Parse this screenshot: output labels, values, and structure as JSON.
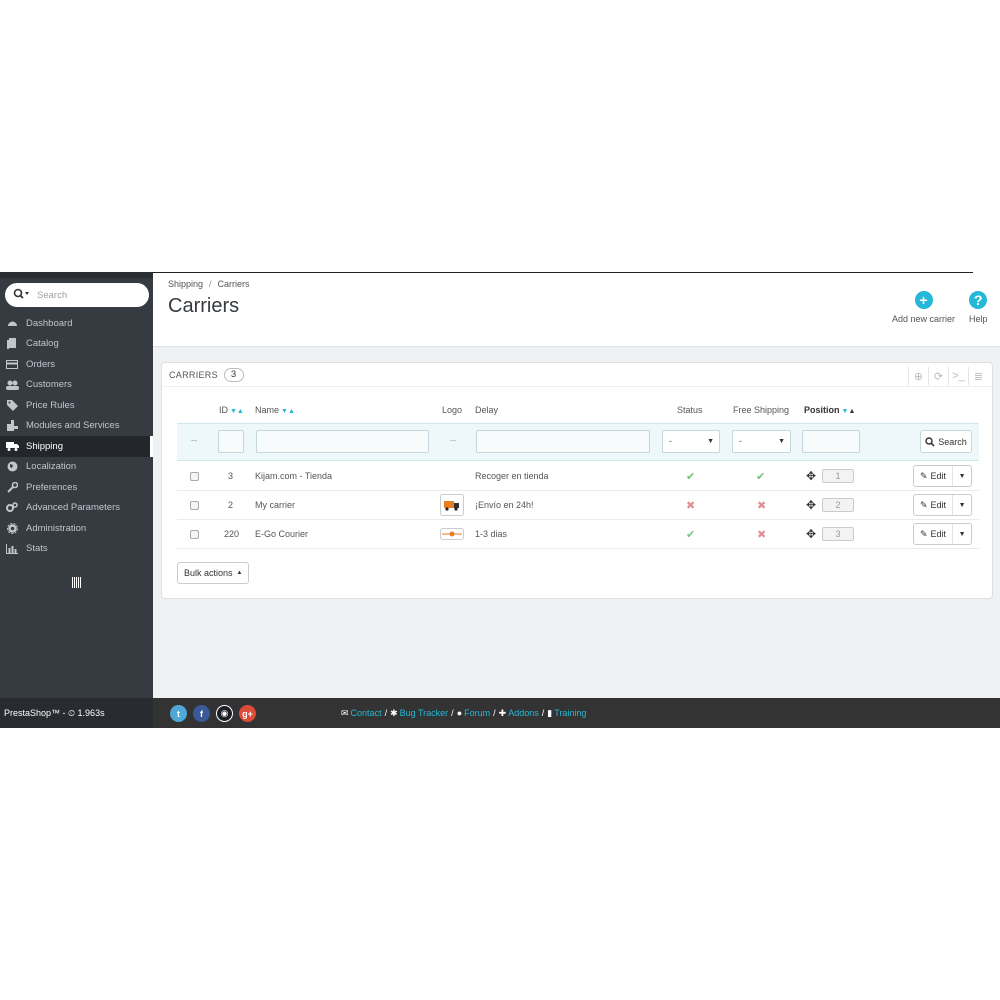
{
  "sidebar": {
    "search_placeholder": "Search",
    "items": [
      {
        "label": "Dashboard",
        "icon": "dashboard-icon"
      },
      {
        "label": "Catalog",
        "icon": "catalog-icon"
      },
      {
        "label": "Orders",
        "icon": "orders-icon"
      },
      {
        "label": "Customers",
        "icon": "customers-icon"
      },
      {
        "label": "Price Rules",
        "icon": "price-rules-icon"
      },
      {
        "label": "Modules and Services",
        "icon": "modules-icon"
      },
      {
        "label": "Shipping",
        "icon": "shipping-icon",
        "active": true
      },
      {
        "label": "Localization",
        "icon": "localization-icon"
      },
      {
        "label": "Preferences",
        "icon": "preferences-icon"
      },
      {
        "label": "Advanced Parameters",
        "icon": "advanced-icon"
      },
      {
        "label": "Administration",
        "icon": "administration-icon"
      },
      {
        "label": "Stats",
        "icon": "stats-icon"
      }
    ]
  },
  "breadcrumb": {
    "first": "Shipping",
    "second": "Carriers",
    "separator": "/"
  },
  "page": {
    "title": "Carriers"
  },
  "toolbar": {
    "add_label": "Add new carrier",
    "help_label": "Help"
  },
  "panel": {
    "title": "CARRIERS",
    "count": "3"
  },
  "table": {
    "headers": {
      "id": "ID",
      "name": "Name",
      "logo": "Logo",
      "delay": "Delay",
      "status": "Status",
      "free_shipping": "Free Shipping",
      "position": "Position"
    },
    "filter": {
      "dash": "--",
      "select_value": "-",
      "search_label": "Search"
    },
    "rows": [
      {
        "id": "3",
        "name": "Kijam.com - Tienda",
        "logo": "",
        "delay": "Recoger en tienda",
        "status": true,
        "free_shipping": true,
        "position": "1",
        "edit": "Edit"
      },
      {
        "id": "2",
        "name": "My carrier",
        "logo": "truck-logo",
        "delay": "¡Envío en 24h!",
        "status": false,
        "free_shipping": false,
        "position": "2",
        "edit": "Edit"
      },
      {
        "id": "220",
        "name": "E-Go Courier",
        "logo": "ego-logo",
        "delay": "1-3 dias",
        "status": true,
        "free_shipping": false,
        "position": "3",
        "edit": "Edit"
      }
    ]
  },
  "bulk": {
    "label": "Bulk actions"
  },
  "footer": {
    "version": "PrestaShop™ - ⏲ 1.963s",
    "links": [
      "Contact",
      "Bug Tracker",
      "Forum",
      "Addons",
      "Training"
    ]
  },
  "colors": {
    "accent": "#25b9d7",
    "sidebar": "#363a41",
    "ok": "#72c279",
    "no": "#e08f95"
  }
}
